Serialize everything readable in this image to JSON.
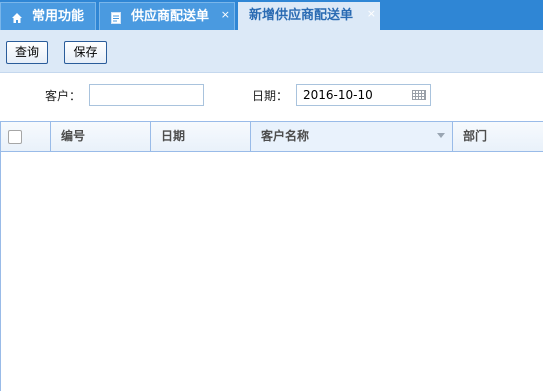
{
  "tabs": [
    {
      "label": "常用功能",
      "icon": "home-icon",
      "state": "inactive"
    },
    {
      "label": "供应商配送单",
      "icon": "document-icon",
      "state": "inactive",
      "close": "×"
    },
    {
      "label": "新增供应商配送单",
      "state": "active",
      "close": "×"
    }
  ],
  "toolbar": {
    "query_label": "查询",
    "save_label": "保存"
  },
  "form": {
    "customer_label": "客户：",
    "customer_value": "",
    "date_label": "日期：",
    "date_value": "2016-10-10"
  },
  "grid": {
    "columns": [
      "编号",
      "日期",
      "客户名称",
      "部门"
    ],
    "rows": []
  },
  "colors": {
    "tabbar": "#2f86d5",
    "active_tab": "#dce9f7",
    "border": "#99bbe8"
  }
}
